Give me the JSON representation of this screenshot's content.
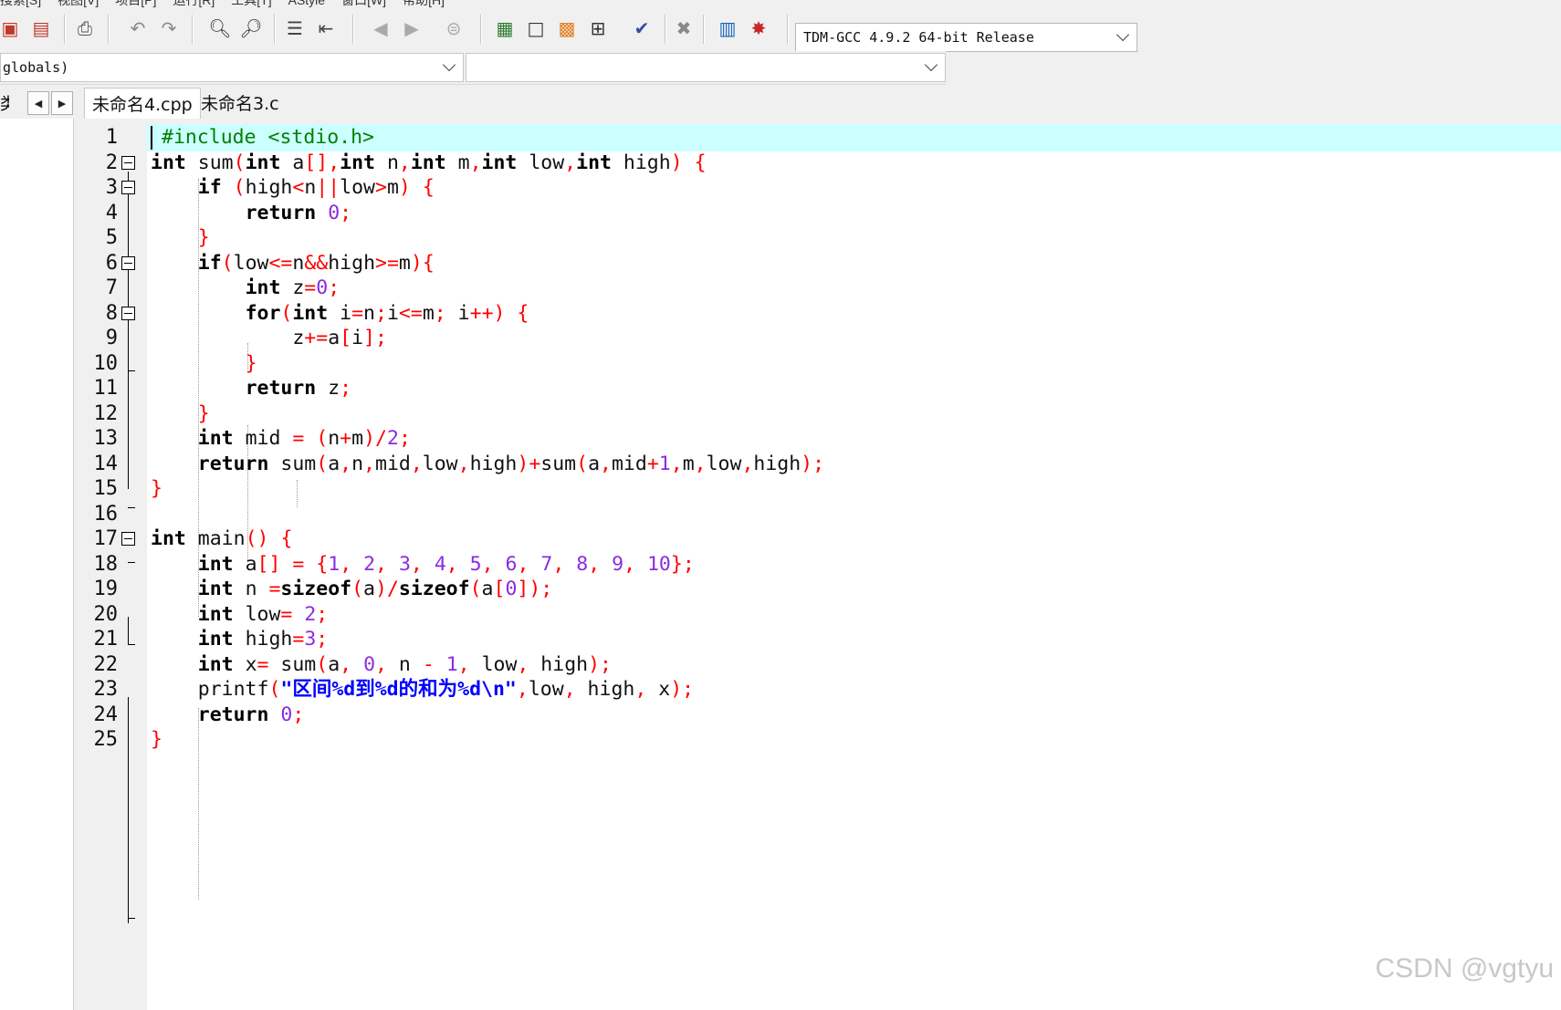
{
  "menu": {
    "items": [
      "搜索[S]",
      "视图[V]",
      "项目[P]",
      "运行[R]",
      "工具[T]",
      "AStyle",
      "窗口[W]",
      "帮助[H]"
    ]
  },
  "toolbar": {
    "compiler": "TDM-GCC 4.9.2 64-bit Release"
  },
  "scope": {
    "globals_label": "globals)",
    "members_value": ""
  },
  "tabs": {
    "left_label": "类",
    "items": [
      {
        "label": "未命名4.cpp",
        "active": true
      },
      {
        "label": "未命名3.c",
        "active": false
      }
    ]
  },
  "code": {
    "line_numbers": [
      "1",
      "2",
      "3",
      "4",
      "5",
      "6",
      "7",
      "8",
      "9",
      "10",
      "11",
      "12",
      "13",
      "14",
      "15",
      "16",
      "17",
      "18",
      "19",
      "20",
      "21",
      "22",
      "23",
      "24",
      "25"
    ],
    "raw_lines": [
      "#include <stdio.h>",
      "int sum(int a[],int n,int m,int low,int high) {",
      "    if (high<n||low>m) {",
      "        return 0;",
      "    }",
      "    if(low<=n&&high>=m){",
      "        int z=0;",
      "        for(int i=n;i<=m; i++) {",
      "            z+=a[i];",
      "        }",
      "        return z;",
      "    }",
      "    int mid = (n+m)/2;",
      "    return sum(a,n,mid,low,high)+sum(a,mid+1,m,low,high);",
      "}",
      "",
      "int main() {",
      "    int a[] = {1, 2, 3, 4, 5, 6, 7, 8, 9, 10};",
      "    int n =sizeof(a)/sizeof(a[0]);",
      "    int low= 2;",
      "    int high=3;",
      "    int x= sum(a, 0, n - 1, low, high);",
      "    printf(\"区间%d到%d的和为%d\\n\",low, high, x);",
      "    return 0;",
      "}"
    ]
  },
  "watermark": "CSDN @vgtyu"
}
